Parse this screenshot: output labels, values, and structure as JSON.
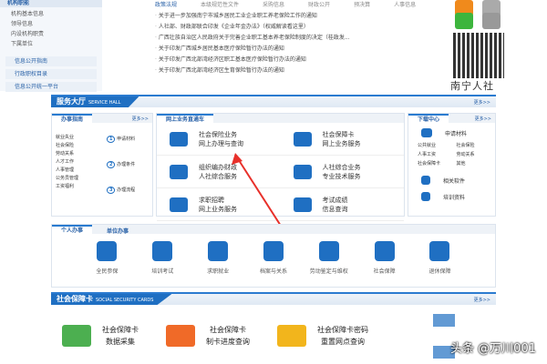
{
  "left_menu": {
    "title": "机构职能",
    "items": [
      "机构基本信息",
      "领导信息",
      "内设机构职责",
      "下属单位"
    ],
    "links": [
      "信息公开指南",
      "行政职权目录",
      "信息公开统一平台"
    ]
  },
  "top_tabs": [
    "政策法规",
    "本级规范性文件",
    "采购信息",
    "财政公开",
    "预决算",
    "人事信息"
  ],
  "news": [
    "关于进一步加强南宁市城乡居民工业企业职工养老保险工作的通知",
    "人社部、财政部联合印发《企业年金办法》（权威解读看这里）",
    "广西壮族自治区人民政府关于完善企业职工基本养老保险制度的决定（桂政发...",
    "关于印发广西城乡居民基本医疗保险暂行办法的通知",
    "关于印发广西北部湾经济区职工基本医疗保险暂行办法的通知",
    "关于印发广西北部湾经济区生育保险暂行办法的通知"
  ],
  "brand": "南宁人社",
  "service_hall": {
    "title": "服务大厅",
    "subtitle": "SERVICE HALL",
    "more": "更多>>",
    "guide": {
      "tab": "办事指南",
      "more": "更多>>",
      "items": [
        "就业失业",
        "社会保险",
        "劳动关系",
        "人才工作",
        "人事管理",
        "公务员管理",
        "工资福利"
      ],
      "steps": [
        {
          "n": "1",
          "label": "申请材料"
        },
        {
          "n": "2",
          "label": "办理条件"
        },
        {
          "n": "3",
          "label": "办理流程"
        }
      ]
    },
    "online": {
      "tab": "网上业务直通车",
      "items": [
        [
          "社会保险业务",
          "网上办理与查询"
        ],
        [
          "社会保障卡",
          "网上业务服务"
        ],
        [
          "组织编办财政",
          "人社综合服务"
        ],
        [
          "人社综合业务",
          "专业技术服务"
        ],
        [
          "求职招聘",
          "网上业务服务"
        ],
        [
          "考试成绩",
          "信息查询"
        ]
      ]
    },
    "download": {
      "tab": "下载中心",
      "more": "更多>>",
      "apply": "申请材料",
      "items": [
        "公共就业",
        "社会保险",
        "人事工资",
        "劳动关系",
        "社会保障卡",
        "其他"
      ],
      "software": "相关软件",
      "training": "培训资料"
    }
  },
  "personal": {
    "tabs": [
      "个人办事",
      "单位办事"
    ],
    "items": [
      "全民参保",
      "培训考试",
      "求职就业",
      "档案与关系",
      "劳动鉴定与维权",
      "社会保障",
      "退休保障"
    ]
  },
  "ss_card": {
    "title": "社会保障卡",
    "subtitle": "SOCIAL SECURITY CARDS",
    "more": "更多>>",
    "items": [
      [
        "社会保障卡",
        "数据采集"
      ],
      [
        "社会保障卡",
        "制卡进度查询"
      ],
      [
        "社会保障卡密码",
        "重置网点查询"
      ]
    ]
  },
  "watermark": "头条 @万川001",
  "colors": {
    "primary": "#1f6fc2",
    "arrow": "#e8302a"
  }
}
